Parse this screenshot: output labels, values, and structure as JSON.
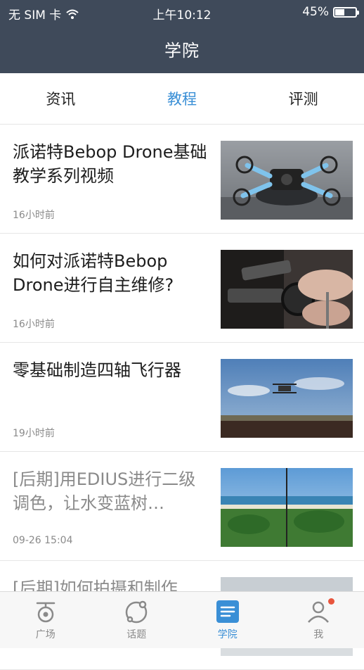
{
  "status_bar": {
    "carrier": "无 SIM 卡",
    "time": "上午10:12",
    "battery": "45%",
    "battery_level": 0.45
  },
  "header": {
    "title": "学院"
  },
  "tabs": [
    {
      "label": "资讯",
      "active": false
    },
    {
      "label": "教程",
      "active": true
    },
    {
      "label": "评测",
      "active": false
    }
  ],
  "articles": [
    {
      "title": "派诺特Bebop Drone基础教学系列视频",
      "time": "16小时前",
      "read": false
    },
    {
      "title": "如何对派诺特Bebop Drone进行自主维修?",
      "time": "16小时前",
      "read": false
    },
    {
      "title": "零基础制造四轴飞行器",
      "time": "19小时前",
      "read": false
    },
    {
      "title": "[后期]用EDIUS进行二级调色，让水变蓝树…",
      "time": "09-26 15:04",
      "read": true
    },
    {
      "title": "[后期]如何拍摄和制作",
      "time": "",
      "read": true
    }
  ],
  "tabbar": [
    {
      "label": "广场",
      "icon": "drone-icon",
      "active": false
    },
    {
      "label": "话题",
      "icon": "topic-icon",
      "active": false
    },
    {
      "label": "学院",
      "icon": "document-icon",
      "active": true
    },
    {
      "label": "我",
      "icon": "profile-icon",
      "active": false,
      "badge": true
    }
  ],
  "colors": {
    "header_bg": "#3f4a5a",
    "accent": "#3a8fd6",
    "badge": "#e8553d"
  }
}
